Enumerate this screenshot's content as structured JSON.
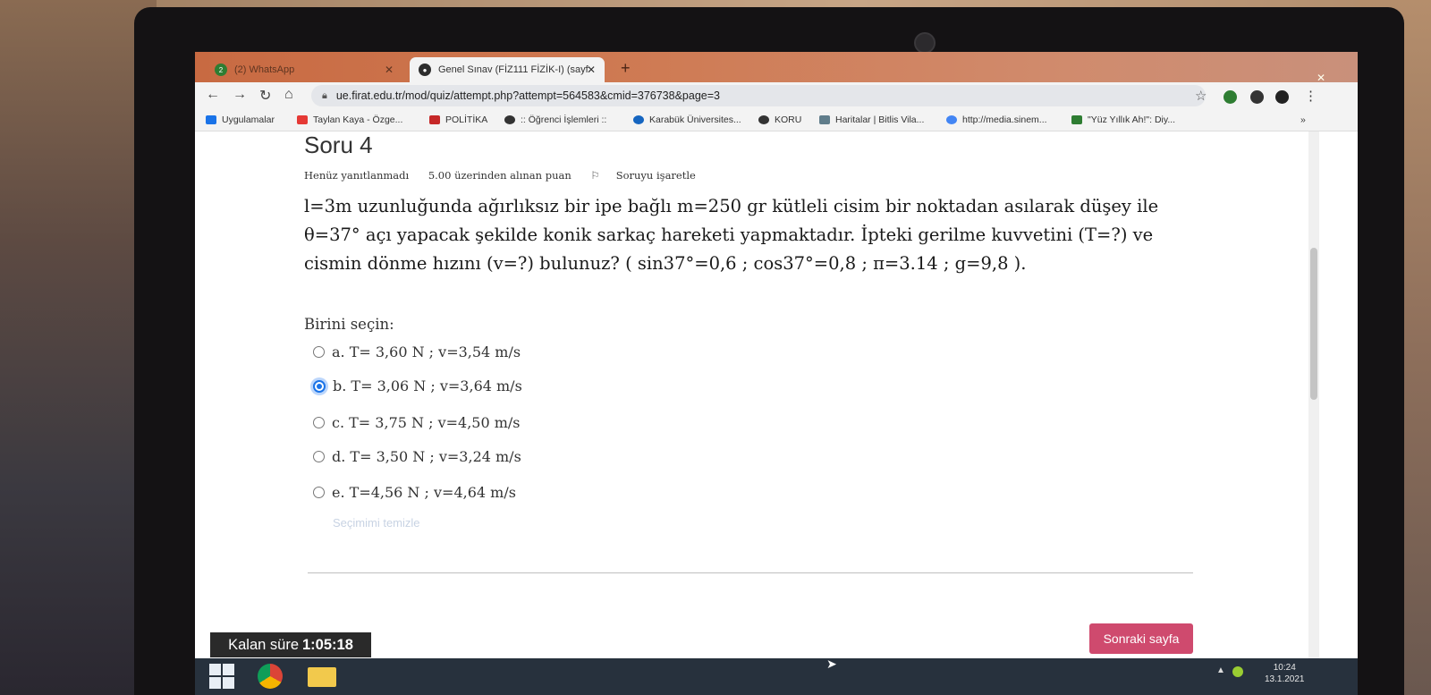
{
  "browser": {
    "tabs": [
      {
        "label": "(2) WhatsApp",
        "icon": "whatsapp-icon",
        "badge": "2"
      },
      {
        "label": "Genel Sınav (FİZ111 FİZİK-I) (sayf",
        "icon": "moodle-icon",
        "active": true
      }
    ],
    "tab_close": "✕",
    "new_tab": "+",
    "window_close": "✕",
    "url": "ue.firat.edu.tr/mod/quiz/attempt.php?attempt=564583&cmid=376738&page=3",
    "bookmarks": [
      {
        "label": "Uygulamalar",
        "color": "#1a73e8"
      },
      {
        "label": "Taylan Kaya - Özge...",
        "color": "#e53935"
      },
      {
        "label": "POLİTİKA",
        "color": "#c62828"
      },
      {
        "label": ":: Öğrenci İşlemleri ::",
        "color": "#333333"
      },
      {
        "label": "Karabük Üniversites...",
        "color": "#1565c0"
      },
      {
        "label": "KORU",
        "color": "#333333"
      },
      {
        "label": "Haritalar | Bitlis Vila...",
        "color": "#607d8b"
      },
      {
        "label": "http://media.sinem...",
        "color": "#4285f4"
      },
      {
        "label": "\"Yüz Yıllık Ah!\": Diy...",
        "color": "#2e7d32"
      }
    ],
    "bookmarks_more": "»"
  },
  "question": {
    "title": "Soru 4",
    "status": "Henüz yanıtlanmadı",
    "points": "5.00 üzerinden alınan puan",
    "flag_label": "Soruyu işaretle",
    "text_line1": "l=3m uzunluğunda ağırlıksız bir ipe bağlı m=250 gr kütleli cisim bir noktadan asılarak düşey ile",
    "text_line2": "θ=37° açı yapacak şekilde konik sarkaç hareketi yapmaktadır. İpteki gerilme kuvvetini (T=?) ve",
    "text_line3": "cismin dönme hızını (v=?) bulunuz? ( sin37°=0,6 ; cos37°=0,8 ; π=3.14 ; g=9,8 ).",
    "choose_label": "Birini seçin:",
    "options": [
      {
        "label": "a. T= 3,60 N ;  v=3,54 m/s",
        "selected": false
      },
      {
        "label": "b. T= 3,06 N  ;  v=3,64 m/s",
        "selected": true
      },
      {
        "label": "c. T= 3,75 N  ;   v=4,50 m/s",
        "selected": false
      },
      {
        "label": "d. T= 3,50 N  ;  v=3,24 m/s",
        "selected": false
      },
      {
        "label": "e. T=4,56 N ;   v=4,64 m/s",
        "selected": false
      }
    ],
    "clear_choice": "Seçimimi temizle"
  },
  "timer": {
    "label": "Kalan süre",
    "value": "1:05:18"
  },
  "next_button": "Sonraki sayfa",
  "taskbar": {
    "time": "10:24",
    "date": "13.1.2021"
  },
  "colors": {
    "accent": "#cf4a6e",
    "tab_bar": "#c86a42",
    "timer_bg": "#2a2a2a",
    "radio_selected": "#1a73e8"
  }
}
